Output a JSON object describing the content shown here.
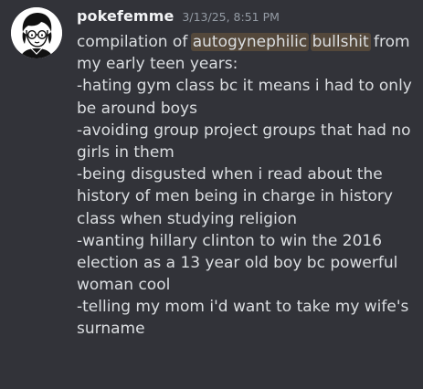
{
  "message": {
    "username": "pokefemme",
    "timestamp": "3/13/25, 8:51 PM",
    "lines": [
      {
        "pre": "compilation of ",
        "hl1": "autogynephilic",
        "mid": " ",
        "hl2": "bullshit",
        "post": " from"
      },
      {
        "text": "my early teen years:"
      },
      {
        "text": "-hating gym class bc it means i had to only"
      },
      {
        "text": "be around boys"
      },
      {
        "text": "-avoiding group project groups that had no"
      },
      {
        "text": "girls in them"
      },
      {
        "text": "-being disgusted when i read about the"
      },
      {
        "text": "history of men being in charge in history"
      },
      {
        "text": "class when studying religion"
      },
      {
        "text": "-wanting hillary clinton to win the 2016"
      },
      {
        "text": "election as a 13 year old boy bc powerful"
      },
      {
        "text": "woman cool"
      },
      {
        "text": "-telling my mom i'd want to take my wife's"
      },
      {
        "text": "surname"
      }
    ]
  },
  "colors": {
    "background": "#323339",
    "username": "#f2f3f5",
    "timestamp": "#949ba4",
    "text": "#dbdee1",
    "highlight": "#54483b"
  },
  "icons": {
    "avatar": "user-avatar-icon"
  }
}
